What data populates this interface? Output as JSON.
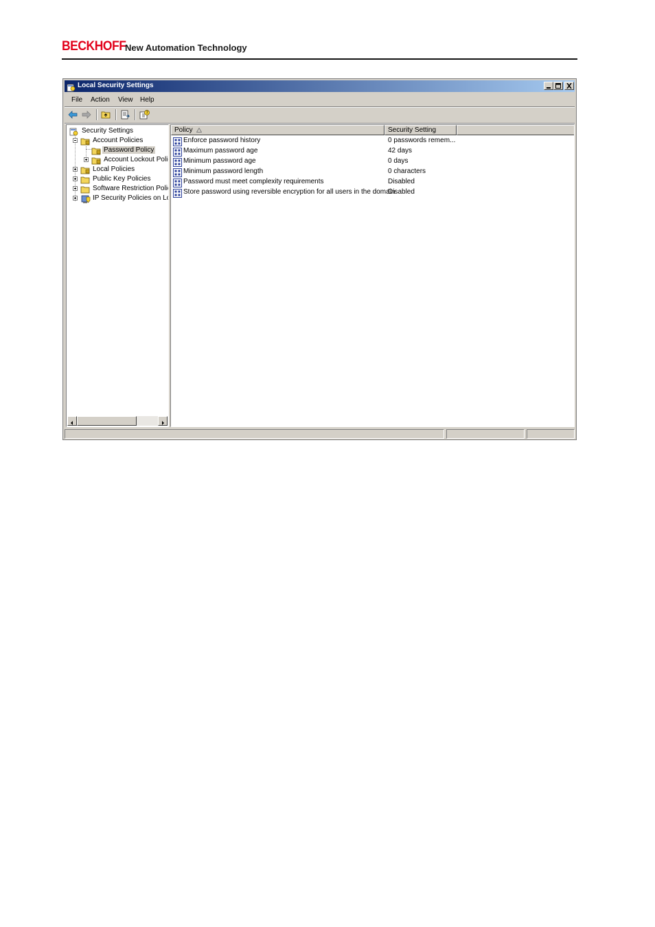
{
  "page_header": {
    "brand": "BECKHOFF",
    "tagline": "New Automation Technology"
  },
  "window": {
    "title": "Local Security Settings",
    "controls": {
      "minimize": "minimize-icon",
      "maximize": "maximize-icon",
      "close": "close-icon"
    }
  },
  "menu": [
    "File",
    "Action",
    "View",
    "Help"
  ],
  "toolbar": [
    "back-arrow-icon",
    "forward-arrow-icon",
    "up-folder-icon",
    "export-list-icon",
    "help-icon"
  ],
  "tree": {
    "root": "Security Settings",
    "items": [
      {
        "label": "Account Policies",
        "state": "expanded"
      },
      {
        "label": "Password Policy",
        "state": "selected"
      },
      {
        "label": "Account Lockout Policy",
        "state": "collapsed"
      },
      {
        "label": "Local Policies",
        "state": "collapsed"
      },
      {
        "label": "Public Key Policies",
        "state": "collapsed"
      },
      {
        "label": "Software Restriction Policies",
        "state": "collapsed"
      },
      {
        "label": "IP Security Policies on Local Computer",
        "state": "collapsed"
      }
    ]
  },
  "list": {
    "columns": [
      "Policy",
      "Security Setting"
    ],
    "sort_indicator": "sort-ascending-icon",
    "rows": [
      {
        "policy": "Enforce password history",
        "setting": "0 passwords remem..."
      },
      {
        "policy": "Maximum password age",
        "setting": "42 days"
      },
      {
        "policy": "Minimum password age",
        "setting": "0 days"
      },
      {
        "policy": "Minimum password length",
        "setting": "0 characters"
      },
      {
        "policy": "Password must meet complexity requirements",
        "setting": "Disabled"
      },
      {
        "policy": "Store password using reversible encryption for all users in the domain",
        "setting": "Disabled"
      }
    ]
  },
  "colors": {
    "brand_red": "#e2001a",
    "titlebar_start": "#0a246a",
    "titlebar_end": "#a6caf0",
    "chrome": "#d4d0c8"
  }
}
